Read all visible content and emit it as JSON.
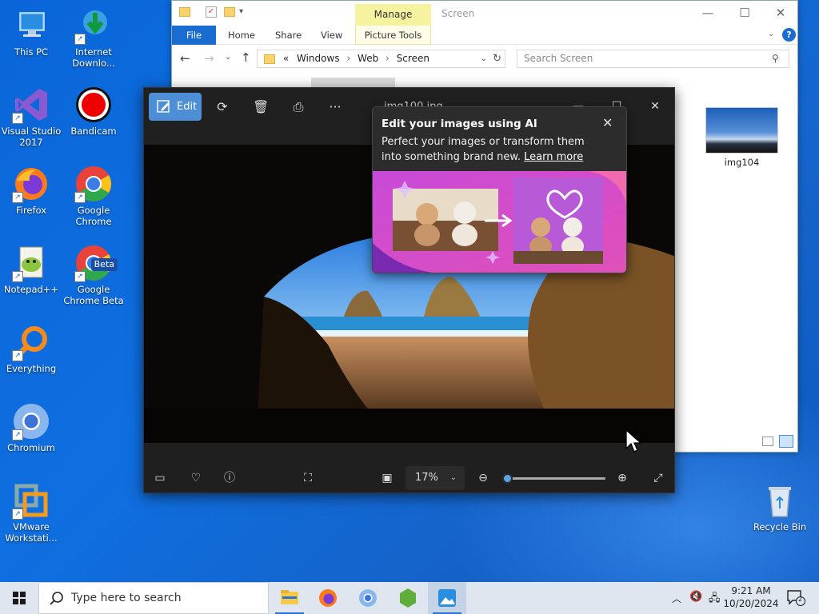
{
  "desktop": {
    "icons": [
      {
        "label": "This PC"
      },
      {
        "label": "Internet Downlo..."
      },
      {
        "label": "Visual Studio 2017"
      },
      {
        "label": "Bandicam"
      },
      {
        "label": "Firefox"
      },
      {
        "label": "Google Chrome"
      },
      {
        "label": "Notepad++"
      },
      {
        "label": "Google Chrome Beta",
        "badge": "Beta"
      },
      {
        "label": "Everything"
      },
      {
        "label": "Chromium"
      },
      {
        "label": "VMware Workstati..."
      },
      {
        "label": "Recycle Bin"
      }
    ]
  },
  "explorer": {
    "title": "Screen",
    "manage_label": "Manage",
    "ribbon_tabs": [
      "File",
      "Home",
      "Share",
      "View",
      "Picture Tools"
    ],
    "breadcrumb": {
      "prefix": "«",
      "parts": [
        "Windows",
        "Web",
        "Screen"
      ]
    },
    "search_placeholder": "Search Screen",
    "help_glyph": "?",
    "files": [
      {
        "name": "img104"
      }
    ]
  },
  "photos": {
    "toolbar": {
      "edit_label": "Edit",
      "more_glyph": "···"
    },
    "title": "img100.jpg",
    "zoom": {
      "label": "17%",
      "level": 0.0
    },
    "ai_popup": {
      "title": "Edit your images using AI",
      "body": "Perfect your images or transform them into something brand new. ",
      "link": "Learn more"
    }
  },
  "taskbar": {
    "search_placeholder": "Type here to search",
    "clock": {
      "time": "9:21 AM",
      "date": "10/20/2024"
    },
    "notification_count": "2"
  },
  "colors": {
    "accent": "#1a6cd0",
    "edit_button": "#4c8fd6",
    "manage_tab": "#f6f3a0"
  }
}
